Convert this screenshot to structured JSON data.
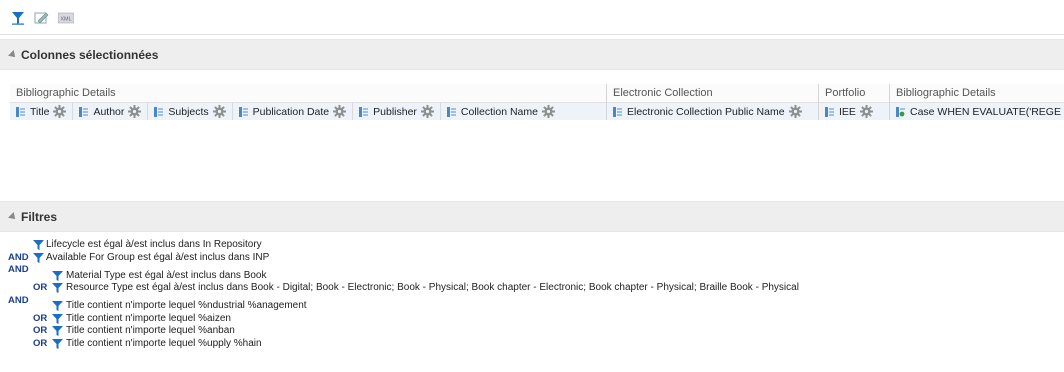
{
  "toolbar": {
    "icons": [
      "filter-icon",
      "edit-formula-icon",
      "xml-icon"
    ],
    "xml_label": "XML"
  },
  "selected_columns": {
    "header": "Colonnes sélectionnées",
    "groups": [
      {
        "name": "Bibliographic Details",
        "columns": [
          "Title",
          "Author",
          "Subjects",
          "Publication Date",
          "Publisher",
          "Collection Name"
        ]
      },
      {
        "name": "Electronic Collection",
        "columns": [
          "Electronic Collection Public Name"
        ]
      },
      {
        "name": "Portfolio",
        "columns": [
          "IEE"
        ]
      },
      {
        "name": "Bibliographic Details",
        "columns": [
          "Case WHEN EVALUATE('REGE"
        ]
      }
    ]
  },
  "filters": {
    "header": "Filtres",
    "rows": [
      {
        "op": "",
        "text": "Lifecycle est égal à/est inclus dans  In Repository"
      },
      {
        "op": "AND",
        "text": "Available For Group est égal à/est inclus dans  INP"
      },
      {
        "op": "AND",
        "text": ""
      },
      {
        "op": "",
        "text": "Material Type est égal à/est inclus dans  Book"
      },
      {
        "op": "OR",
        "text": "Resource Type est égal à/est inclus dans  Book - Digital; Book - Electronic; Book - Physical; Book chapter - Electronic; Book chapter - Physical; Braille Book - Physical"
      },
      {
        "op": "AND",
        "text": ""
      },
      {
        "op": "",
        "text": "Title  contient n'importe lequel %ndustrial %anagement"
      },
      {
        "op": "OR",
        "text": "Title  contient n'importe lequel %aizen"
      },
      {
        "op": "OR",
        "text": "Title  contient n'importe lequel %anban"
      },
      {
        "op": "OR",
        "text": "Title  contient n'importe lequel %upply %hain"
      }
    ]
  },
  "colors": {
    "filter_blue": "#1a6fc4",
    "op_blue": "#1a3f8f",
    "header_bg": "#eeeeee",
    "column_bg": "#eef3fa"
  }
}
